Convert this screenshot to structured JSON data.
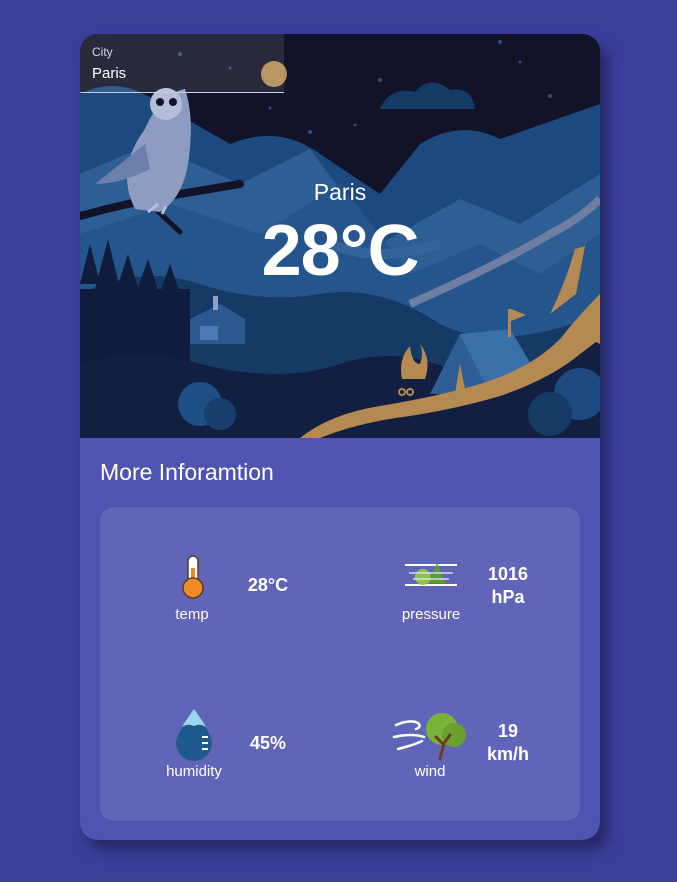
{
  "search": {
    "label": "City",
    "value": "Paris"
  },
  "hero": {
    "city": "Paris",
    "temperature": "28°C"
  },
  "section_title": "More Inforamtion",
  "stats": {
    "temp": {
      "label": "temp",
      "value": "28°C",
      "icon": "thermometer-icon"
    },
    "pressure": {
      "label": "pressure",
      "value_line1": "1016",
      "value_line2": "hPa",
      "icon": "pressure-icon"
    },
    "humidity": {
      "label": "humidity",
      "value": "45%",
      "icon": "water-drop-icon"
    },
    "wind": {
      "label": "wind",
      "value_line1": "19",
      "value_line2": "km/h",
      "icon": "wind-tree-icon"
    }
  },
  "colors": {
    "page_background": "#3b3f9a",
    "card_background": "#4f54b3",
    "panel_background": "#6065b8",
    "night_sky": "#121228"
  }
}
